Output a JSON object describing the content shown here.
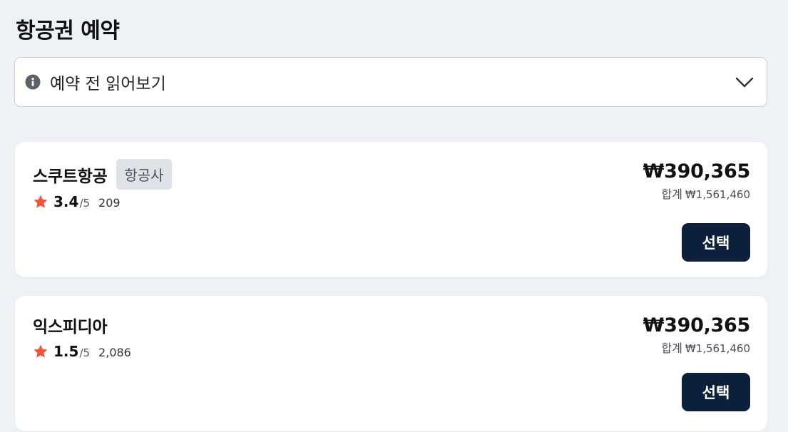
{
  "page": {
    "title": "항공권 예약"
  },
  "notice": {
    "label": "예약 전 읽어보기",
    "icon": "info-icon",
    "toggle_icon": "chevron-down-icon"
  },
  "offers": [
    {
      "provider": "스쿠트항공",
      "badge": "항공사",
      "score": "3.4",
      "scale": "/5",
      "reviews": "209",
      "price": "₩390,365",
      "total_label": "합계",
      "total_amount": "₩1,561,460",
      "select_label": "선택"
    },
    {
      "provider": "익스피디아",
      "score": "1.5",
      "scale": "/5",
      "reviews": "2,086",
      "price": "₩390,365",
      "total_label": "합계",
      "total_amount": "₩1,561,460",
      "select_label": "선택"
    }
  ],
  "colors": {
    "background": "#eef1f6",
    "star": "#f2533b",
    "button": "#0c1f3b",
    "badge_bg": "#dfe2e7"
  }
}
